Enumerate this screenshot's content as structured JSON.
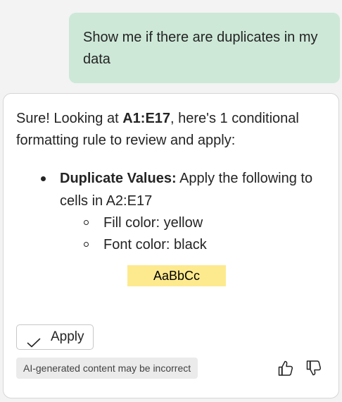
{
  "user_message": {
    "text": "Show me if there are duplicates in my data"
  },
  "response": {
    "intro_prefix": "Sure! Looking at ",
    "intro_range": "A1:E17",
    "intro_suffix": ", here's 1 conditional formatting rule to review and apply:",
    "rule": {
      "name": "Duplicate Values:",
      "description": " Apply the following to cells in A2:E17"
    },
    "details": [
      "Fill color: yellow",
      "Font color: black"
    ],
    "preview_text": "AaBbCc",
    "preview_fill": "#fdea8f",
    "preview_font": "#000000"
  },
  "actions": {
    "apply_label": "Apply",
    "disclaimer": "AI-generated content may be incorrect",
    "thumbs_up_icon": "thumbs-up-icon",
    "thumbs_down_icon": "thumbs-down-icon"
  },
  "colors": {
    "user_bubble": "#cde8d7",
    "card_background": "#ffffff",
    "page_background": "#f3f3f3"
  }
}
